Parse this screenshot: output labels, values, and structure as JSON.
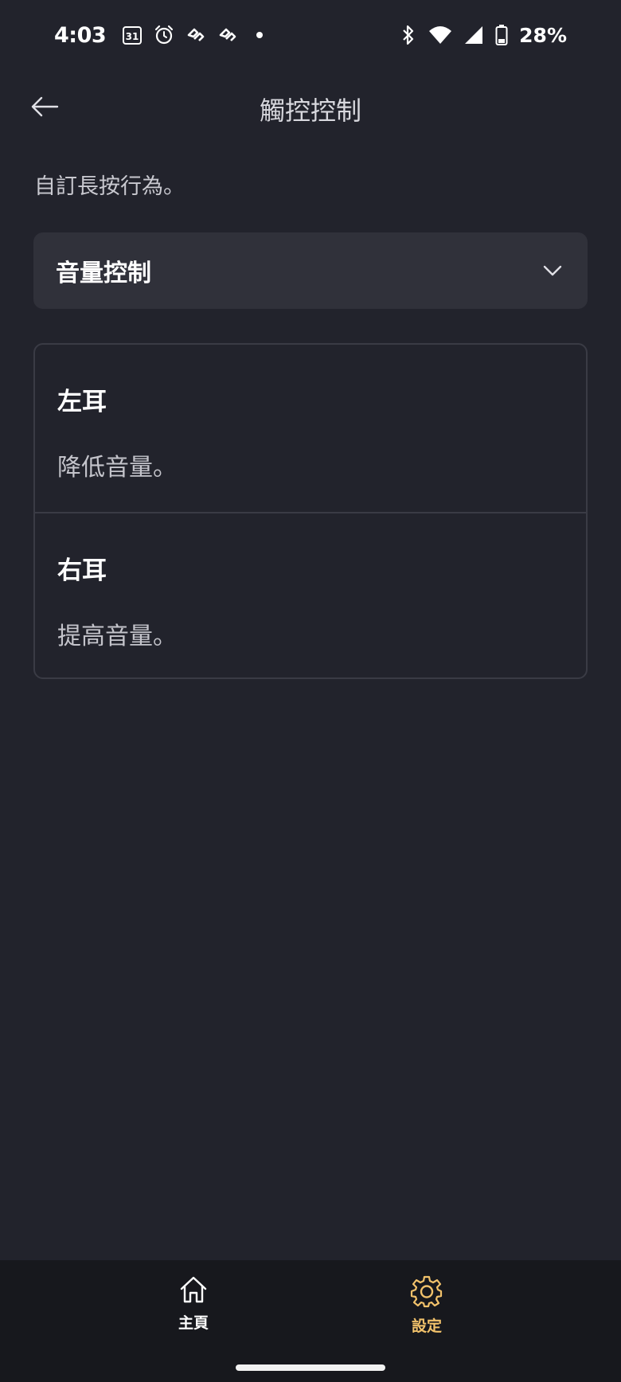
{
  "status_bar": {
    "time": "4:03",
    "calendar_date": "31",
    "battery": "28%"
  },
  "app_bar": {
    "title": "觸控控制"
  },
  "description": "自訂長按行為。",
  "dropdown": {
    "selected": "音量控制"
  },
  "ears": [
    {
      "label": "左耳",
      "action": "降低音量。"
    },
    {
      "label": "右耳",
      "action": "提高音量。"
    }
  ],
  "bottom_nav": {
    "home_label": "主頁",
    "settings_label": "設定",
    "active_color": "#f2c26b",
    "inactive_color": "#ffffff"
  },
  "icons": {
    "back": "arrow-left-icon",
    "dropdown": "chevron-down-icon",
    "home": "home-icon",
    "settings": "gear-icon"
  }
}
